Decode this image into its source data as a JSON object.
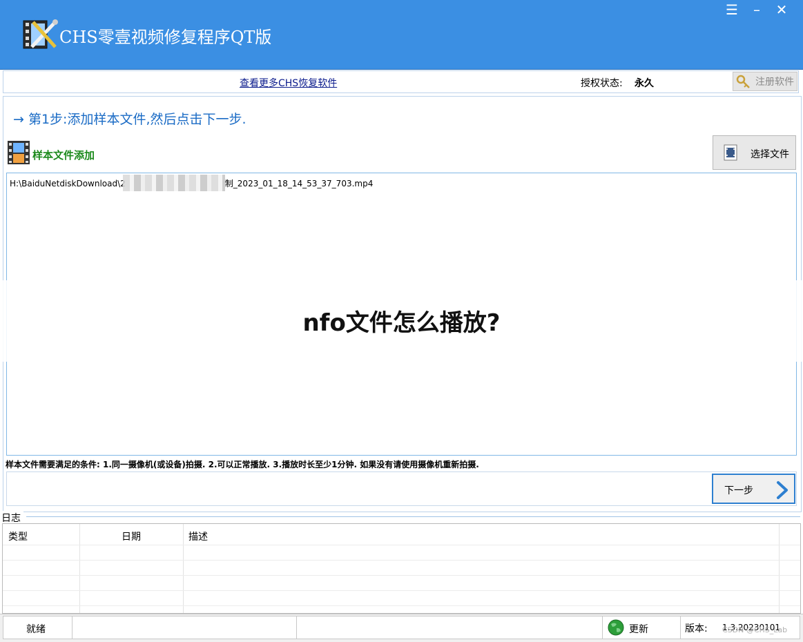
{
  "window": {
    "title": "CHS零壹视频修复程序QT版",
    "controls": {
      "menu": "☰",
      "minimize": "–",
      "close": "✕"
    }
  },
  "infobar": {
    "more_link": "查看更多CHS恢复软件",
    "auth_label": "授权状态:",
    "auth_value": "永久",
    "register_button": "注册软件"
  },
  "step": {
    "label": "→ 第1步:添加样本文件,然后点击下一步."
  },
  "sample": {
    "title": "样本文件添加",
    "choose_button": "选择文件",
    "files": [
      {
        "prefix": "H:\\BaiduNetdiskDownload\\2",
        "suffix": "制_2023_01_18_14_53_37_703.mp4"
      }
    ],
    "hint": "样本文件需要满足的条件: 1.同一摄像机(或设备)拍摄. 2.可以正常播放. 3.播放时长至少1分钟. 如果没有请使用摄像机重新拍摄."
  },
  "next_button": "下一步",
  "log": {
    "legend": "日志",
    "columns": [
      "类型",
      "日期",
      "描述"
    ]
  },
  "statusbar": {
    "status": "就绪",
    "update": "更新",
    "version_label": "版本:",
    "version_value": "1.3.20230101"
  },
  "overlay": {
    "text": "nfo文件怎么播放?",
    "watermark": "CSDN @CHS_Lab"
  },
  "colors": {
    "titlebar": "#3b8fe3",
    "step_text": "#1a6bc5",
    "sample_title": "#1c8a1c",
    "accent_border": "#2d7fd0"
  }
}
